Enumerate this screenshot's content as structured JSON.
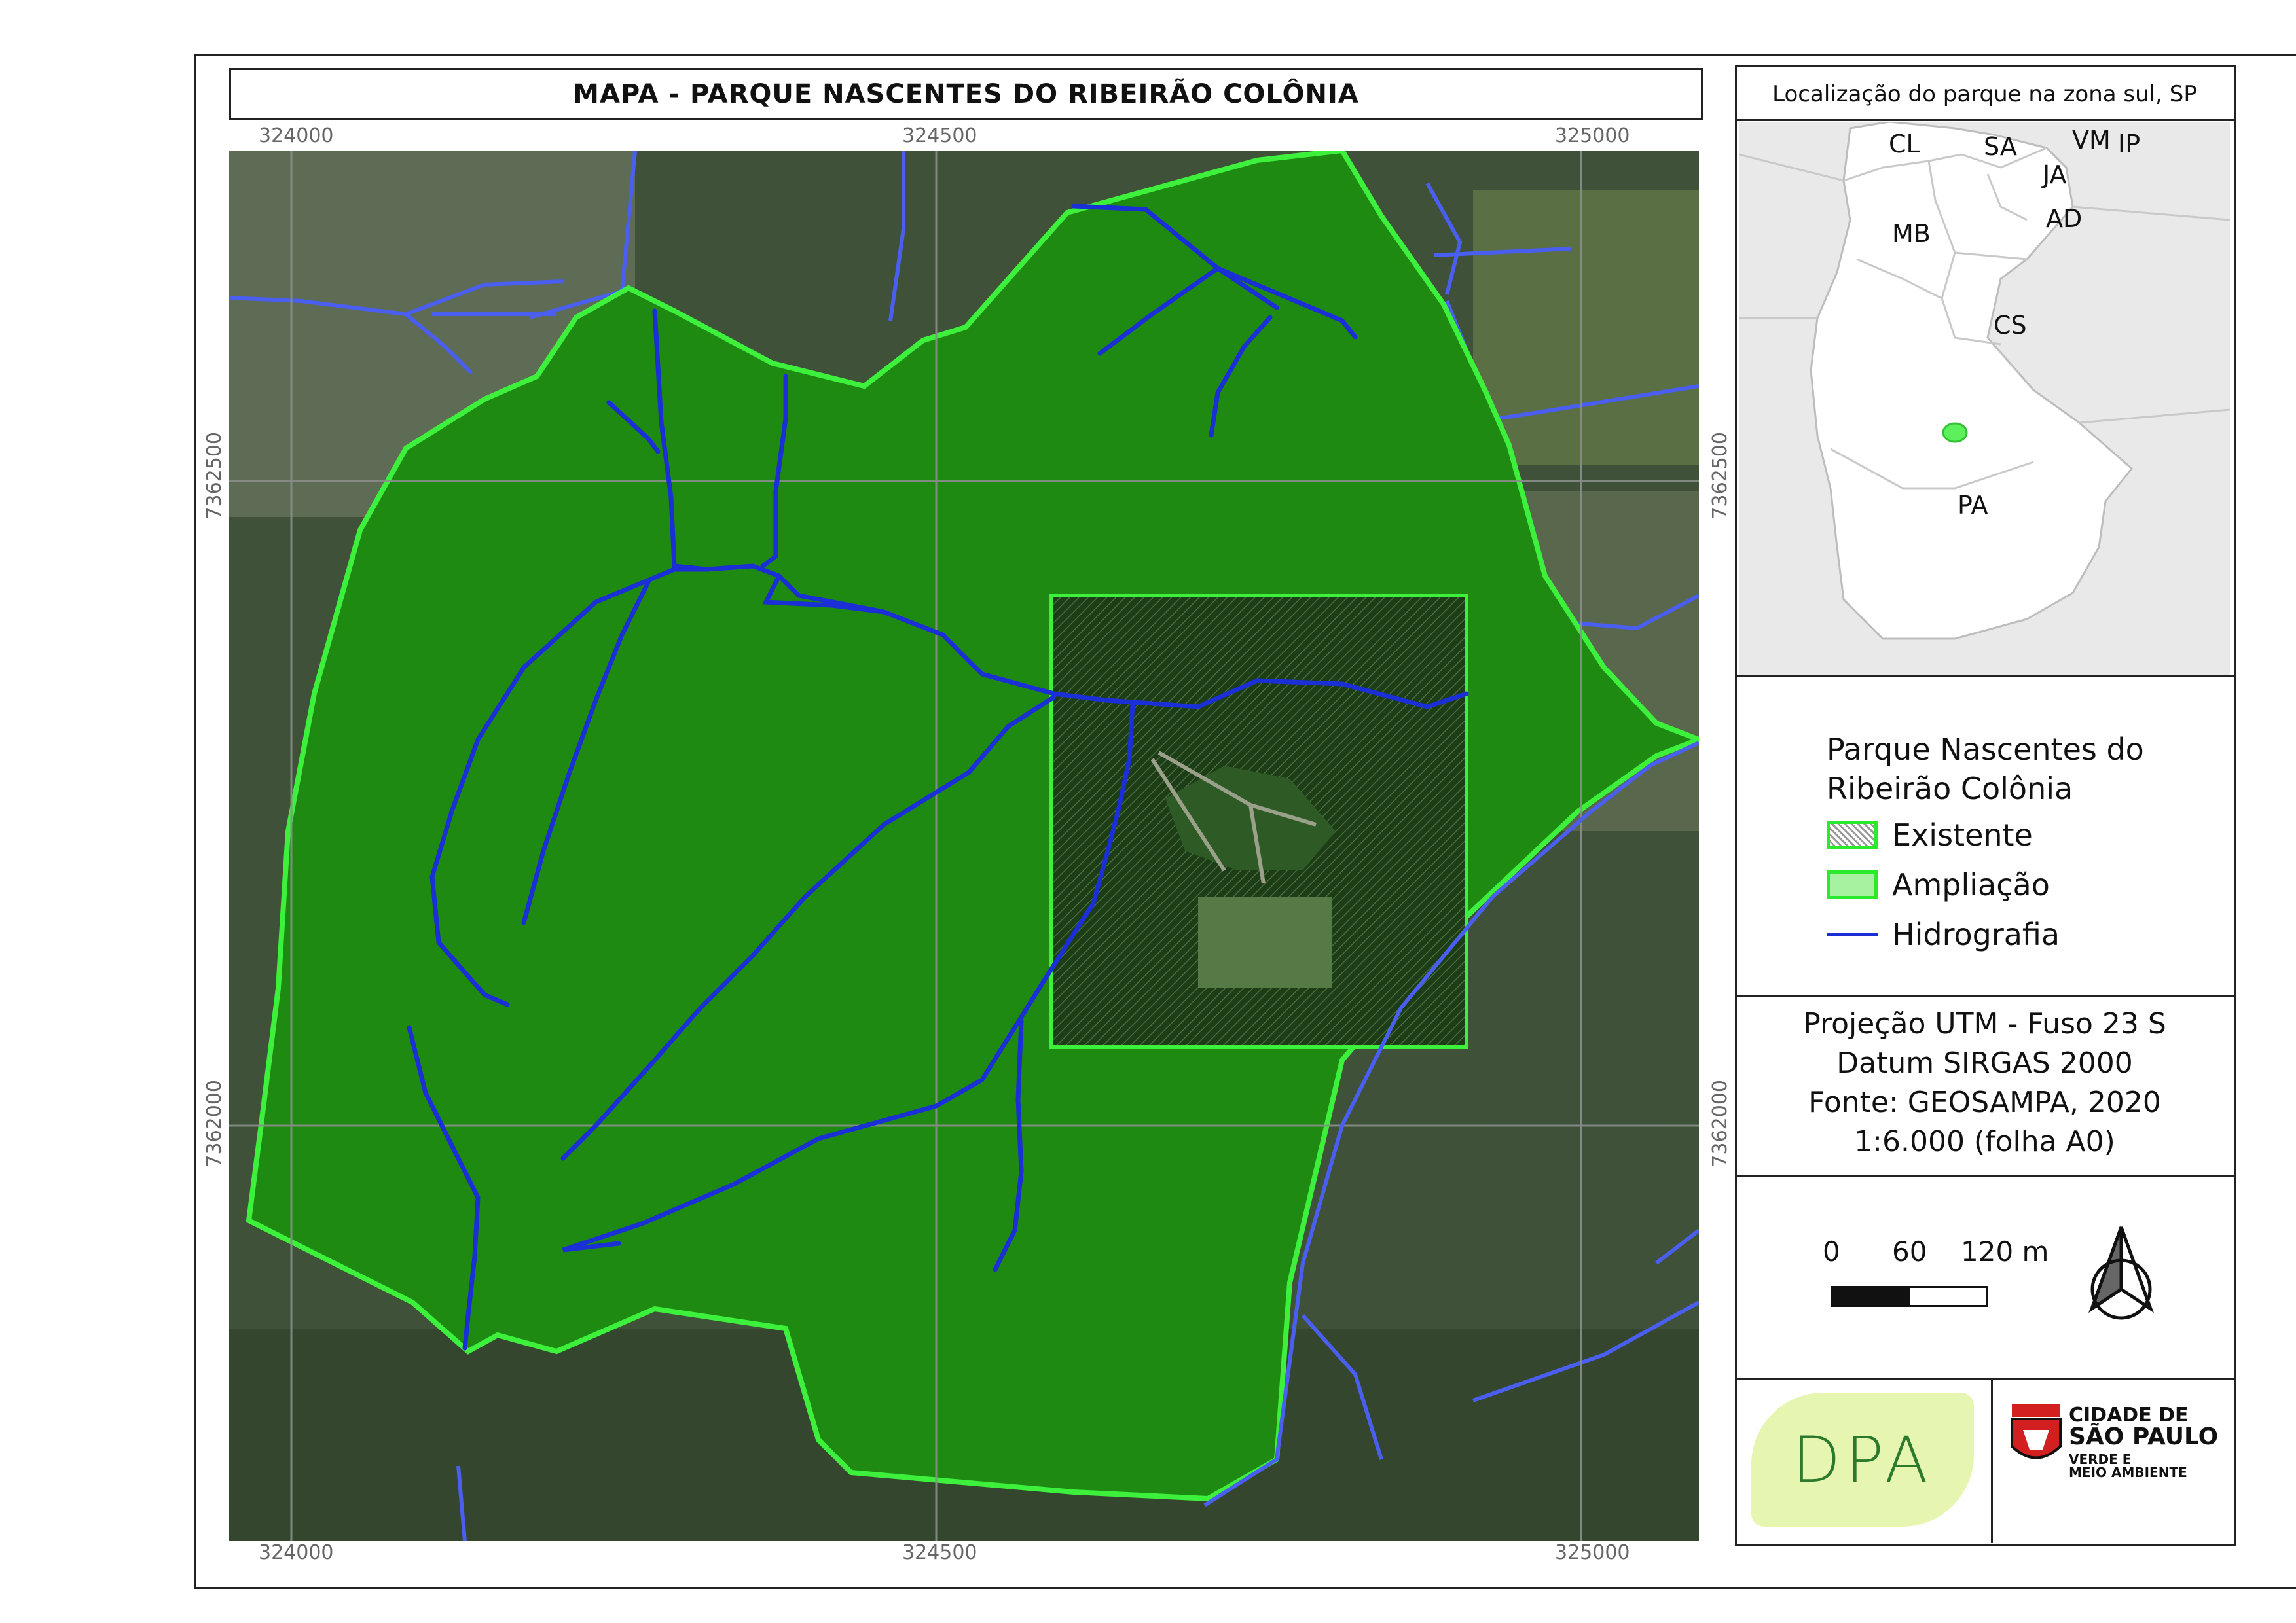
{
  "title": "MAPA -  PARQUE NASCENTES DO RIBEIRÃO COLÔNIA",
  "grid": {
    "x_top": [
      "324000",
      "324500",
      "325000"
    ],
    "x_bottom": [
      "324000",
      "324500",
      "325000"
    ],
    "y_left": [
      "7362500",
      "7362000"
    ],
    "y_right": [
      "7362500",
      "7362000"
    ]
  },
  "inset": {
    "title": "Localização do parque na zona sul, SP",
    "districts": [
      "CL",
      "SA",
      "VM",
      "IP",
      "JA",
      "AD",
      "MB",
      "CS",
      "PA"
    ]
  },
  "legend": {
    "heading_line1": "Parque Nascentes do",
    "heading_line2": "Ribeirão Colônia",
    "items": [
      {
        "label": "Existente",
        "style": "hatched"
      },
      {
        "label": "Ampliação",
        "style": "light-green"
      },
      {
        "label": "Hidrografia",
        "style": "blue-line"
      }
    ]
  },
  "projection": {
    "line1": "Projeção UTM - Fuso 23 S",
    "line2": "Datum SIRGAS 2000",
    "line3": "Fonte: GEOSAMPA, 2020",
    "line4": "1:6.000   (folha A0)"
  },
  "scale_bar": {
    "labels": [
      "0",
      "60",
      "120 m"
    ]
  },
  "north_arrow": {
    "icon": "north-arrow-icon"
  },
  "logos": {
    "dpa_text": "DPA",
    "city_line1": "CIDADE DE",
    "city_line2": "SÃO PAULO",
    "city_line3": "VERDE E",
    "city_line4": "MEIO AMBIENTE"
  },
  "colors": {
    "park_fill": "#1e8a12",
    "park_outline": "#3cf03c",
    "hydrography": "#1a2fd6",
    "hydro_outside": "#4a5ef0",
    "satellite": "#41533c",
    "dpa_bg": "#e6f5b0",
    "dpa_text": "#2c7a2c"
  }
}
